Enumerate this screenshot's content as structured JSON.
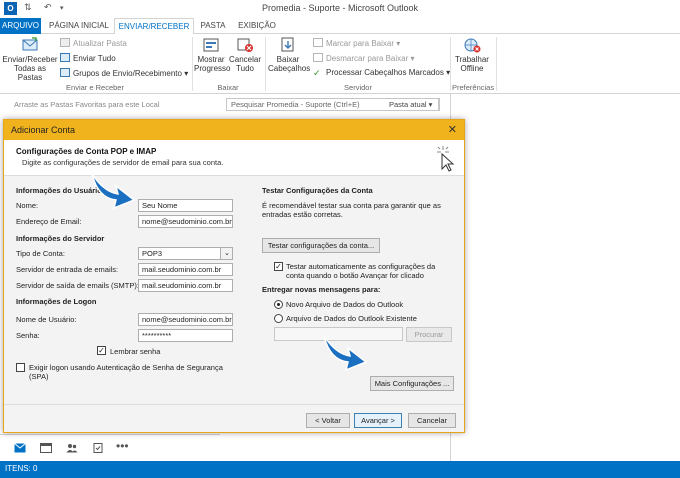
{
  "window": {
    "title": "Promedia - Suporte - Microsoft Outlook",
    "app_icon": "O"
  },
  "tabs": [
    "ARQUIVO",
    "PÁGINA INICIAL",
    "ENVIAR/RECEBER",
    "PASTA",
    "EXIBIÇÃO"
  ],
  "ribbon": {
    "send_receive_all": "Enviar/Receber\nTodas as Pastas",
    "update_folder": "Atualizar Pasta",
    "send_all": "Enviar Tudo",
    "send_groups": "Grupos de Envio/Recebimento",
    "show_progress": "Mostrar\nProgresso",
    "cancel_all": "Cancelar\nTudo",
    "download_headers": "Baixar\nCabeçalhos",
    "mark_download": "Marcar para Baixar",
    "unmark_download": "Desmarcar para Baixar",
    "process_headers": "Processar Cabeçalhos Marcados",
    "work_offline": "Trabalhar\nOffline",
    "groups": {
      "send_receive": "Enviar e Receber",
      "download": "Baixar",
      "server": "Servidor",
      "preferences": "Preferências"
    }
  },
  "favorites_hint": "Arraste as Pastas Favoritas para este Local",
  "search": {
    "placeholder": "Pesquisar Promedia - Suporte (Ctrl+E)",
    "scope": "Pasta atual"
  },
  "status": {
    "items": "ITENS: 0"
  },
  "colors": {
    "accent": "#0072c6",
    "dialog_title": "#f0b31d",
    "arrow": "#1a6fc0"
  },
  "dialog": {
    "title": "Adicionar Conta",
    "header_title": "Configurações de Conta POP e IMAP",
    "header_subtitle": "Digite as configurações de servidor de email para sua conta.",
    "user_info_heading": "Informações do Usuário",
    "name_label": "Nome:",
    "name_value": "Seu Nome",
    "email_label": "Endereço de Email:",
    "email_value": "nome@seudominio.com.br",
    "server_info_heading": "Informações do Servidor",
    "account_type_label": "Tipo de Conta:",
    "account_type_value": "POP3",
    "incoming_label": "Servidor de entrada de emails:",
    "incoming_value": "mail.seudominio.com.br",
    "outgoing_label": "Servidor de saída de emails (SMTP):",
    "outgoing_value": "mail.seudominio.com.br",
    "logon_heading": "Informações de Logon",
    "username_label": "Nome de Usuário:",
    "username_value": "nome@seudominio.com.br",
    "password_label": "Senha:",
    "password_value": "**********",
    "remember_password": "Lembrar senha",
    "spa_label": "Exigir logon usando Autenticação de Senha de Segurança\n(SPA)",
    "test_heading": "Testar Configurações da Conta",
    "test_description": "É recomendável testar sua conta para garantir que as\nentradas estão corretas.",
    "test_button": "Testar configurações da conta...",
    "auto_test_label": "Testar automaticamente as configurações da\nconta quando o botão Avançar for clicado",
    "deliver_heading": "Entregar novas mensagens para:",
    "new_data_file": "Novo Arquivo de Dados do Outlook",
    "existing_data_file": "Arquivo de Dados do Outlook Existente",
    "browse_button": "Procurar",
    "more_settings_button": "Mais Configurações ...",
    "back_button": "< Voltar",
    "next_button": "Avançar >",
    "cancel_button": "Cancelar"
  }
}
